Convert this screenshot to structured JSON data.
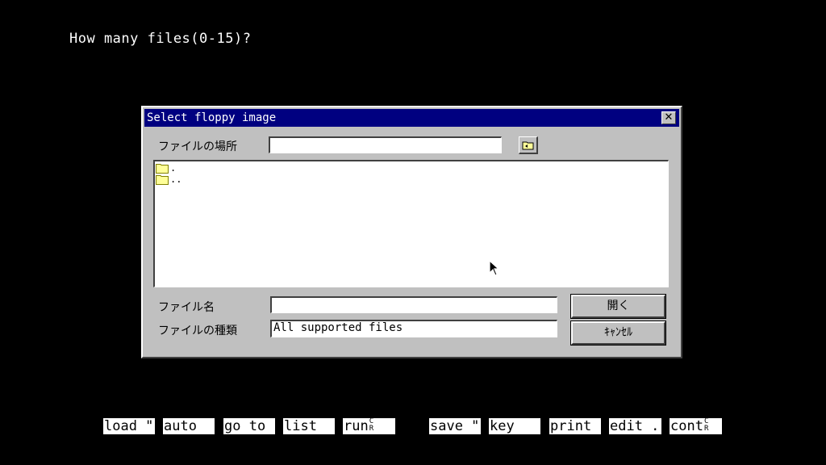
{
  "prompt": "How many files(0-15)?",
  "dialog": {
    "title": "Select floppy image",
    "close_glyph": "✕",
    "location_label": "ファイルの場所",
    "location_value": "",
    "files": [
      {
        "name": ".",
        "icon": "folder-icon"
      },
      {
        "name": "..",
        "icon": "folder-icon"
      }
    ],
    "filename_label": "ファイル名",
    "filename_value": "",
    "filetype_label": "ファイルの種類",
    "filetype_value": "All supported files",
    "open_label": "開く",
    "cancel_label": "ｷｬﾝｾﾙ"
  },
  "function_keys": [
    "load \"",
    "auto",
    "go to",
    "list",
    "run",
    "save \"",
    "key",
    "print",
    "edit .",
    "cont"
  ],
  "colors": {
    "titlebar": "#000080",
    "dialog_bg": "#c0c0c0",
    "screen_bg": "#000000",
    "folder": "#ffff99"
  }
}
